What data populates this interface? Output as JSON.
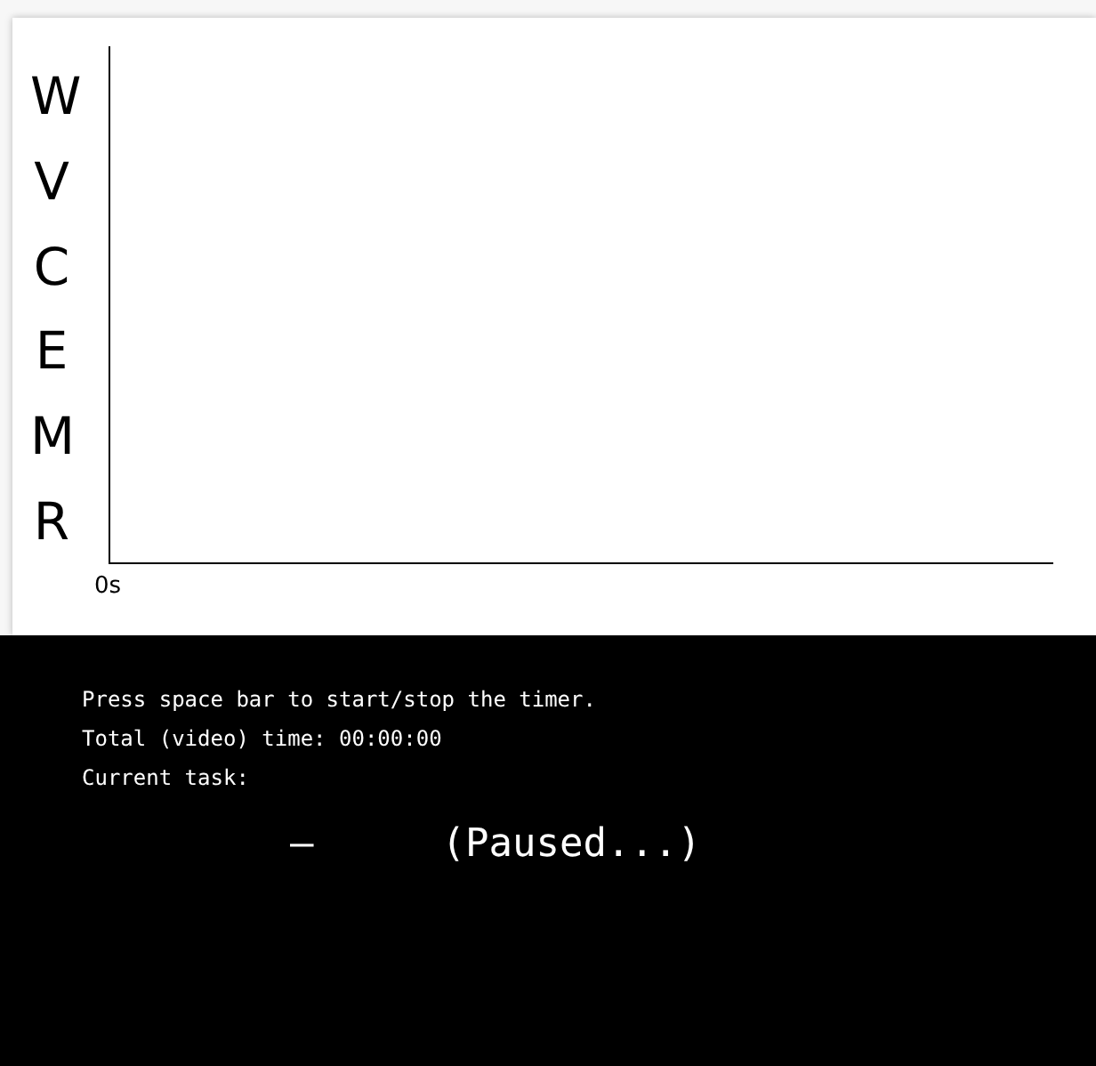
{
  "timeline": {
    "row_labels": [
      "W",
      "V",
      "C",
      "E",
      "M",
      "R"
    ],
    "x_axis_label": "0s"
  },
  "console": {
    "lines": [
      "Press space bar to start/stop the timer.",
      "Total (video) time: 00:00:00",
      "Current task:"
    ],
    "task": "–",
    "status": "(Paused...)"
  }
}
